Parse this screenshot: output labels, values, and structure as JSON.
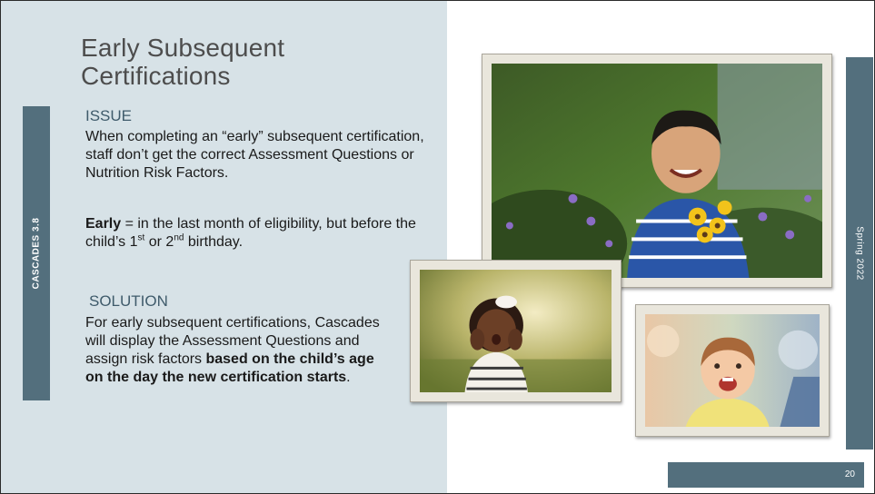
{
  "slide": {
    "title": "Early Subsequent Certifications",
    "left_bar_label": "CASCADES 3.8",
    "right_bar_label": "Spring 2022",
    "page_number": "20"
  },
  "issue": {
    "heading": "ISSUE",
    "text": "When completing an “early” subsequent certification, staff don’t get the correct Assessment Questions or Nutrition Risk Factors.",
    "early_term": "Early",
    "early_def_start": " = in the last month of eligibility, but before the child’s 1",
    "early_sup1": "st",
    "early_mid": " or 2",
    "early_sup2": "nd",
    "early_end": " birthday."
  },
  "solution": {
    "heading": "SOLUTION",
    "text_start": "For early subsequent certifications, Cascades will display the Assessment Questions and assign risk factors ",
    "text_bold": "based on the child’s age on the day the new certification starts",
    "text_end": "."
  },
  "colors": {
    "panel": "#d7e2e7",
    "bar": "#536f7d",
    "title": "#4d4d4d",
    "heading": "#3f5b6b",
    "frame": "#e9e6dc"
  },
  "photos": {
    "boy": "smiling-boy-with-yellow-flowers",
    "girl": "toddler-girl-hands-on-cheeks",
    "baby": "laughing-baby-girl"
  }
}
